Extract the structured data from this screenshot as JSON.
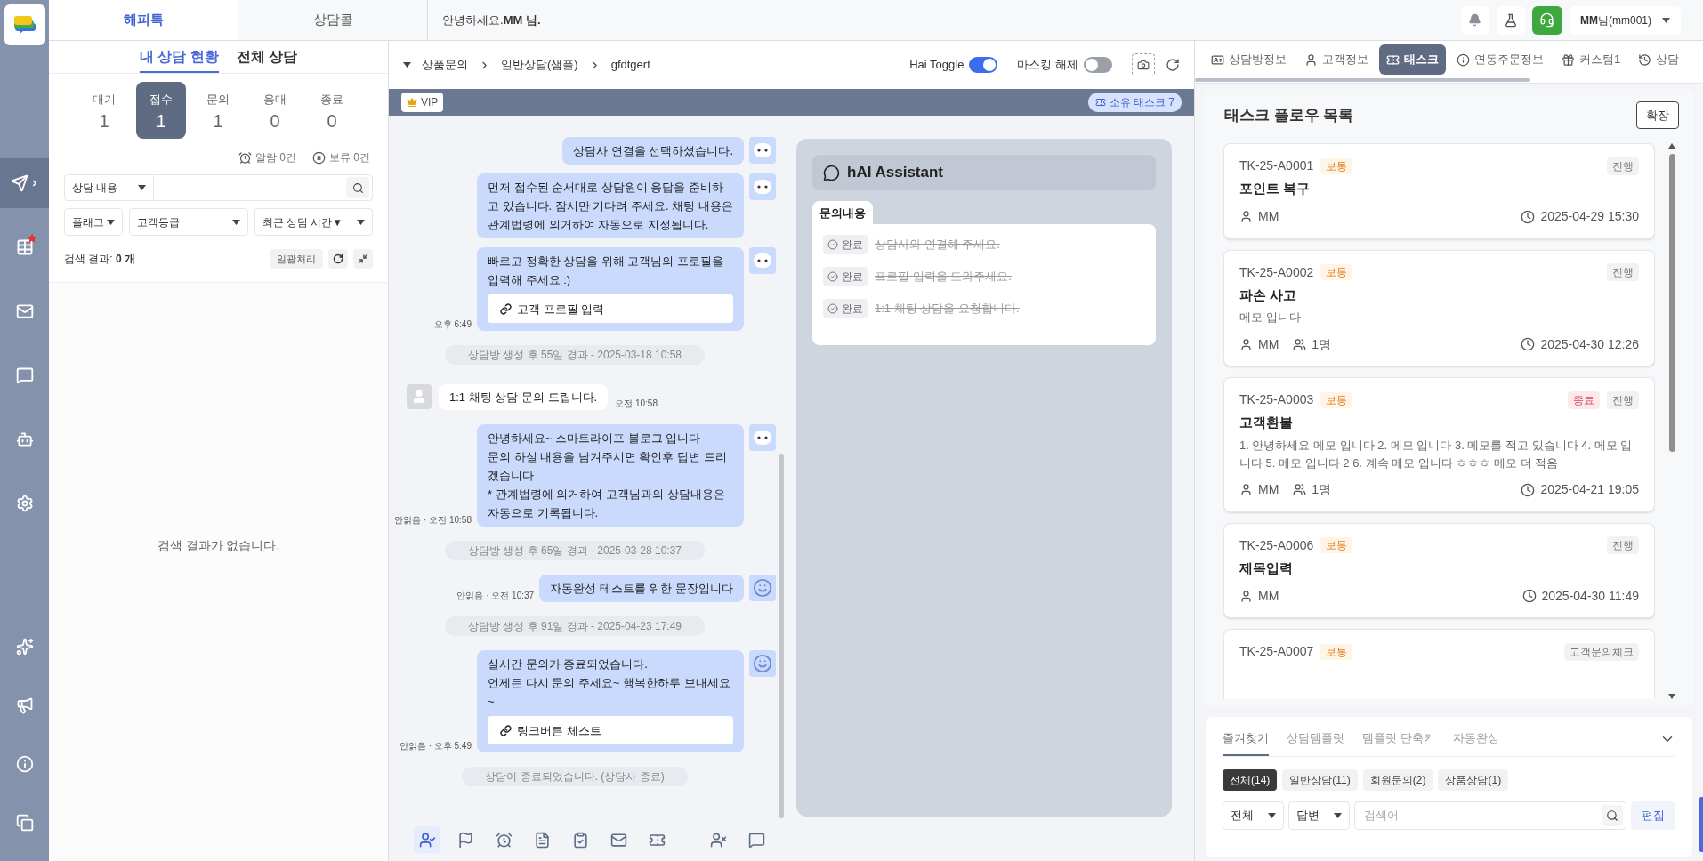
{
  "rail": {
    "top": [
      {
        "kind": "send",
        "selected": true,
        "starred": false
      },
      {
        "kind": "table",
        "selected": false,
        "starred": true
      },
      {
        "kind": "mail",
        "selected": false,
        "starred": false
      },
      {
        "kind": "chat-edit",
        "selected": false,
        "starred": false
      },
      {
        "kind": "robot",
        "selected": false,
        "starred": false
      },
      {
        "kind": "settings",
        "selected": false,
        "starred": false
      }
    ],
    "bottom": [
      {
        "kind": "sparkle",
        "selected": false,
        "starred": false
      },
      {
        "kind": "megaphone",
        "selected": false,
        "starred": false
      },
      {
        "kind": "info",
        "selected": false,
        "starred": false
      },
      {
        "kind": "copy",
        "selected": false,
        "starred": false
      }
    ]
  },
  "top_tabs": [
    {
      "label": "해피톡",
      "selected": true
    },
    {
      "label": "상담콜",
      "selected": false
    }
  ],
  "greeting": "안녕하세요.**MM 님.**",
  "user_menu": "**MM**님(mm001)",
  "left": {
    "tabs": [
      {
        "label": "내 상담 현황",
        "selected": true
      },
      {
        "label": "전체 상담",
        "selected": false
      }
    ],
    "counters": [
      {
        "label": "대기",
        "count": "1",
        "selected": false
      },
      {
        "label": "접수",
        "count": "1",
        "selected": true
      },
      {
        "label": "문의",
        "count": "1",
        "selected": false
      },
      {
        "label": "응대",
        "count": "0",
        "selected": false
      },
      {
        "label": "종료",
        "count": "0",
        "selected": false
      }
    ],
    "alarm": "알람 0건",
    "hold": "보류 0건",
    "search_scope": "상담 내용",
    "filters": [
      "플래그",
      "고객등급",
      "최근 상담 시간▼"
    ],
    "result": "검색 결과: **0 개**",
    "bulk_button": "일괄처리",
    "empty": "검색 결과가 없습니다."
  },
  "chat": {
    "breadcrumb": [
      "상품문의",
      "일반상담(샘플)",
      "gfdtgert"
    ],
    "toggles": [
      {
        "label": "Hai Toggle",
        "on": true
      },
      {
        "label": "마스킹 해제",
        "on": false
      }
    ],
    "vip": "VIP",
    "owned_tasks": "소유 태스크 7",
    "messages": [
      {
        "kind": "agent",
        "avatar": {
          "kind": "bot"
        },
        "text": "상담사 연결을 선택하셨습니다."
      },
      {
        "kind": "agent",
        "avatar": {
          "kind": "bot"
        },
        "text": "먼저 접수된 순서대로 상담원이 응답을 준비하고 있습니다. 잠시만 기다려 주세요. 채팅 내용은 관계법령에 의거하여 자동으로 지정됩니다."
      },
      {
        "kind": "agent",
        "avatar": {
          "kind": "bot"
        },
        "text": "빠르고 정확한 상담을 위해 고객님의 프로필을 입력해 주세요 :)",
        "link": "고객 프로필 입력",
        "meta": "오후 6:49"
      },
      {
        "kind": "system",
        "text": "상담방 생성 후 55일 경과 - 2025-03-18 10:58"
      },
      {
        "kind": "customer",
        "text": "1:1 채팅 상담 문의 드립니다.",
        "meta": "오전 10:58"
      },
      {
        "kind": "agent",
        "avatar": {
          "kind": "bot"
        },
        "text": "안녕하세요~ 스마트라이프 블로그 입니다\n문의 하실 내용을 남겨주시면 확인후 답변 드리겠습니다\n* 관계법령에 의거하여 고객님과의 상담내용은 자동으로 기록됩니다.",
        "meta": "안읽음 · 오전 10:58"
      },
      {
        "kind": "system",
        "text": "상담방 생성 후 65일 경과 - 2025-03-28 10:37"
      },
      {
        "kind": "agent",
        "avatar": {
          "kind": "smile"
        },
        "text": "자동완성 테스트를 위한 문장입니다",
        "meta": "안읽음 · 오전 10:37"
      },
      {
        "kind": "system",
        "text": "상담방 생성 후 91일 경과 - 2025-04-23 17:49"
      },
      {
        "kind": "agent",
        "avatar": {
          "kind": "smile"
        },
        "text": "실시간 문의가 종료되었습니다.\n언제든 다시 문의 주세요~ 행복한하루 보내세요~",
        "link": "링크버튼 체스트",
        "meta": "안읽음 · 오후 5:49"
      },
      {
        "kind": "system",
        "text": "상담이 종료되었습니다. (상담사 종료)"
      }
    ],
    "toolbar": {
      "left": [
        {
          "kind": "user-check",
          "selected": true
        },
        {
          "kind": "flag",
          "selected": false
        },
        {
          "kind": "alarm",
          "selected": false
        },
        {
          "kind": "document",
          "selected": false
        },
        {
          "kind": "clipboard",
          "selected": false
        },
        {
          "kind": "mail",
          "selected": false
        },
        {
          "kind": "ticket",
          "selected": false
        }
      ],
      "right": [
        {
          "kind": "user-off",
          "selected": false
        },
        {
          "kind": "chat-edit",
          "selected": false
        }
      ]
    }
  },
  "assistant": {
    "title": "hAI Assistant",
    "tab": "문의내용",
    "items": [
      {
        "status": "완료",
        "text": "상담사와 연결해 주세요.",
        "done": true
      },
      {
        "status": "완료",
        "text": "프로필 입력을 도와주세요.",
        "done": true
      },
      {
        "status": "완료",
        "text": "1:1 채팅 상담을 요청합니다.",
        "done": true
      }
    ]
  },
  "right": {
    "tabs": [
      {
        "label": "상담방정보",
        "selected": false
      },
      {
        "label": "고객정보",
        "selected": false
      },
      {
        "label": "태스크",
        "selected": true
      },
      {
        "label": "연동주문정보",
        "selected": false
      },
      {
        "label": "커스텀1",
        "selected": false
      },
      {
        "label": "상담",
        "selected": false
      }
    ],
    "title": "태스크 플로우 목록",
    "expand_button": "확장",
    "tasks": [
      {
        "id": "TK-25-A0001",
        "priority": "보통",
        "tags": [
          {
            "label": "진행",
            "kind": "stage"
          }
        ],
        "title": "포인트 복구",
        "assignee": "MM",
        "time": "2025-04-29 15:30"
      },
      {
        "id": "TK-25-A0002",
        "priority": "보통",
        "tags": [
          {
            "label": "진행",
            "kind": "stage"
          }
        ],
        "title": "파손 사고",
        "memo": "메모 입니다",
        "assignee": "MM",
        "participants": "1명",
        "time": "2025-04-30 12:26"
      },
      {
        "id": "TK-25-A0003",
        "priority": "보통",
        "tags": [
          {
            "label": "종료",
            "kind": "closed"
          },
          {
            "label": "진행",
            "kind": "stage"
          }
        ],
        "title": "고객환불",
        "memo": "1. 안녕하세요 메모 입니다 2. 메모 입니다 3. 메모를 적고 있습니다 4. 메모 입니다 5. 메모 입니다 2 6. 계속 메모 입니다 ㅎㅎㅎ 메모 더 적음",
        "assignee": "MM",
        "participants": "1명",
        "time": "2025-04-21 19:05"
      },
      {
        "id": "TK-25-A0006",
        "priority": "보통",
        "tags": [
          {
            "label": "진행",
            "kind": "stage"
          }
        ],
        "title": "제목입력",
        "assignee": "MM",
        "time": "2025-04-30 11:49"
      },
      {
        "id": "TK-25-A0007",
        "priority": "보통",
        "tags": [
          {
            "label": "고객문의체크",
            "kind": "stage"
          }
        ]
      }
    ],
    "bottom": {
      "tabs": [
        {
          "label": "즐겨찾기",
          "selected": true
        },
        {
          "label": "상담템플릿",
          "selected": false
        },
        {
          "label": "템플릿 단축키",
          "selected": false
        },
        {
          "label": "자동완성",
          "selected": false
        }
      ],
      "chips": [
        {
          "label": "전체(14)",
          "selected": true
        },
        {
          "label": "일반상담(11)",
          "selected": false
        },
        {
          "label": "회원문의(2)",
          "selected": false
        },
        {
          "label": "상품상담(1)",
          "selected": false
        }
      ],
      "selects": [
        "전체",
        "답변"
      ],
      "search_placeholder": "검색어",
      "edit_button": "편집"
    }
  }
}
